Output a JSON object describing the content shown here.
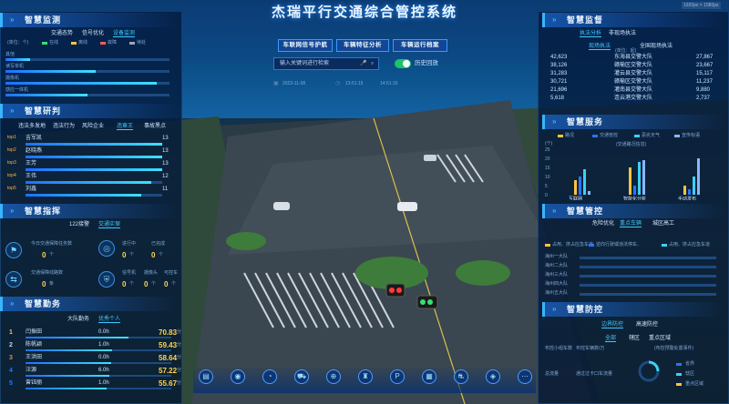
{
  "title": "杰瑞平行交通综合管控系统",
  "dimension_badge": "1920px × 1080px",
  "top_buttons": [
    "车联网信号护航",
    "车辆特征分析",
    "车辆运行档案"
  ],
  "search": {
    "placeholder": "输入关键词进行检索",
    "toggle_label": "历史回放",
    "date": "2023-11-08",
    "time_from": "13:51:15",
    "time_to": "14:51:15"
  },
  "left": {
    "monitor": {
      "title": "智慧监测",
      "tabs": [
        "交通态势",
        "信号优化",
        "设备监测"
      ],
      "unit": "(单位：个)",
      "legend": [
        "在线",
        "离线",
        "故障",
        "待处"
      ],
      "rows": [
        {
          "label": "其他",
          "value": 0.15
        },
        {
          "label": "读写单机",
          "value": 0.55
        },
        {
          "label": "摄像机",
          "value": 0.92
        },
        {
          "label": "感应一体机",
          "value": 0.5
        }
      ]
    },
    "research": {
      "title": "智慧研判",
      "tabs": [
        "违法多发地",
        "违法行为",
        "风险企业",
        "违章王",
        "事故黑点"
      ],
      "rows": [
        {
          "rank": "top1",
          "name": "吉军凯",
          "value": "13"
        },
        {
          "rank": "top2",
          "name": "赵晓燕",
          "value": "13"
        },
        {
          "rank": "top3",
          "name": "王芳",
          "value": "13"
        },
        {
          "rank": "top4",
          "name": "王伟",
          "value": "12"
        },
        {
          "rank": "top5",
          "name": "刘鑫",
          "value": "11"
        }
      ]
    },
    "command": {
      "title": "智慧指挥",
      "tabs": [
        "122接警",
        "交通实保"
      ],
      "stats": [
        {
          "label": "今日交通保障任务数",
          "value": "0",
          "unit": "个"
        },
        {
          "label": "进行中",
          "value": "0",
          "unit": "个"
        },
        {
          "label": "已完成",
          "value": "0",
          "unit": "个"
        },
        {
          "label": "交通保障线路数",
          "value": "0",
          "unit": "条"
        },
        {
          "label": "信号机",
          "value": "0",
          "unit": "个"
        },
        {
          "label": "摄像头",
          "value": "0",
          "unit": "个"
        },
        {
          "label": "可控车",
          "value": "0",
          "unit": "个"
        }
      ]
    },
    "duty": {
      "title": "智慧勤务",
      "tabs": [
        "大队勤务",
        "优秀个人"
      ],
      "rows": [
        {
          "rank": "1",
          "name": "闫振田",
          "hours": "0.0h",
          "score": "70.83",
          "unit": "分"
        },
        {
          "rank": "2",
          "name": "陈帆颖",
          "hours": "1.0h",
          "score": "59.43",
          "unit": "分"
        },
        {
          "rank": "3",
          "name": "王洪田",
          "hours": "0.0h",
          "score": "58.64",
          "unit": "分"
        },
        {
          "rank": "4",
          "name": "汪源",
          "hours": "6.0h",
          "score": "57.22",
          "unit": "分"
        },
        {
          "rank": "5",
          "name": "曾钰丽",
          "hours": "1.0h",
          "score": "55.67",
          "unit": "分"
        }
      ]
    }
  },
  "right": {
    "supervise": {
      "title": "智慧监督",
      "tabs": [
        "执法分析",
        "非现场执法"
      ],
      "subtabs": [
        "现场执法",
        "全国现场执法"
      ],
      "unit": "(单位：起)",
      "rows": [
        {
          "left": "42,623",
          "name": "东海县交警大队",
          "right": "27,867"
        },
        {
          "left": "38,126",
          "name": "赣榆区交警大队",
          "right": "23,667"
        },
        {
          "left": "31,283",
          "name": "灌云县交警大队",
          "right": "15,117"
        },
        {
          "left": "30,721",
          "name": "赣榆区交警大队",
          "right": "11,237"
        },
        {
          "left": "21,696",
          "name": "灌南县交警大队",
          "right": "9,880"
        },
        {
          "left": "5,618",
          "name": "连云港交警大队",
          "right": "2,737"
        }
      ]
    },
    "service": {
      "title": "智慧服务",
      "unit": "(个)",
      "legend": [
        "路况",
        "交通管控",
        "恶劣天气",
        "宣传标语"
      ],
      "chart_label": "(交通路况信息)",
      "categories": [
        "互联网",
        "智能化分析",
        "手动发布"
      ]
    },
    "control": {
      "title": "智慧管控",
      "tabs": [
        "危险优化",
        "重点车辆",
        "城区高工"
      ],
      "legend": [
        "占用、挤占应急车道",
        "逆向行驶或违法停车、",
        "占用、挤占应急车道"
      ],
      "rows": [
        "海州一大队",
        "海州二大队",
        "海州三大队",
        "海州四大队",
        "海州五大队"
      ]
    },
    "prevent": {
      "title": "智慧防控",
      "tabs": [
        "边界防控",
        "高速防控"
      ],
      "subtabs": [
        "全部",
        "辖区",
        "重点区域"
      ],
      "labels": [
        "布控小组车数",
        "布控车辆数/万",
        "总流量",
        "通过过卡口车流量"
      ],
      "legend_title": "(布控预警处置事件)",
      "legend": [
        "省界",
        "辖区",
        "重点区域"
      ]
    }
  },
  "dock": {
    "icons": [
      "road-icon",
      "camera-icon",
      "speedometer-icon",
      "car-icon",
      "signal-icon",
      "police-icon",
      "parking-icon",
      "chip-icon",
      "vehicle-icon",
      "location-icon",
      "more-icon"
    ]
  },
  "chart_data": {
    "type": "bar",
    "title": "",
    "categories": [
      "互联网",
      "智能化分析",
      "手动发布"
    ],
    "series": [
      {
        "name": "路况",
        "values": [
          8,
          15,
          5
        ]
      },
      {
        "name": "交通管控",
        "values": [
          10,
          5,
          3
        ]
      },
      {
        "name": "恶劣天气",
        "values": [
          14,
          18,
          10
        ]
      },
      {
        "name": "宣传标语",
        "values": [
          2,
          19,
          20
        ]
      }
    ],
    "ylim": [
      0,
      25
    ],
    "colors": [
      "#ffc440",
      "#2a74ff",
      "#3cd1f3",
      "#8bb6ff"
    ]
  }
}
